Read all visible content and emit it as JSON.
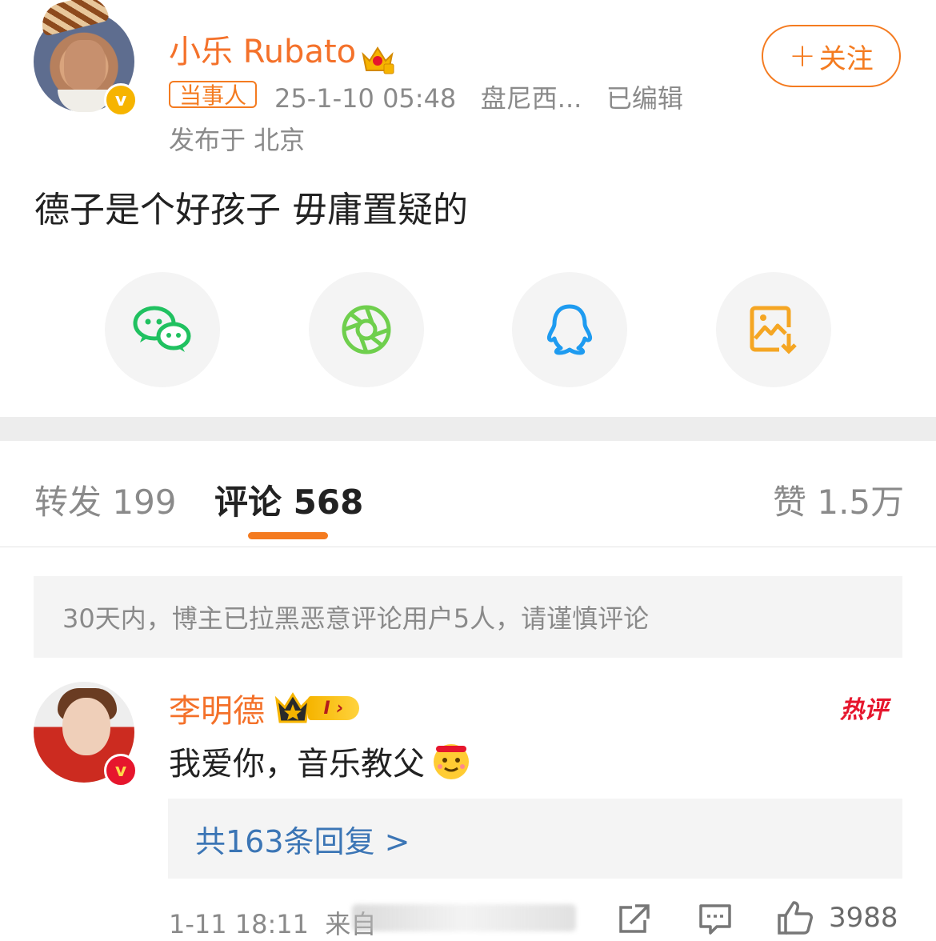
{
  "post": {
    "username": "小乐 Rubato",
    "tag": "当事人",
    "timestamp": "25-1-10 05:48",
    "source": "盘尼西...",
    "edited": "已编辑",
    "location": "发布于 北京",
    "follow_label": "关注",
    "content": "德子是个好孩子 毋庸置疑的"
  },
  "share": {
    "items": [
      {
        "name": "wechat-icon"
      },
      {
        "name": "moments-icon"
      },
      {
        "name": "qq-icon"
      },
      {
        "name": "save-image-icon"
      }
    ],
    "colors": {
      "wechat": "#20c160",
      "moments": "#6fcf4d",
      "qq": "#1e9bf0",
      "save": "#f5a623"
    }
  },
  "tabs": {
    "repost": "转发 199",
    "comments": "评论 568",
    "likes": "赞 1.5万"
  },
  "notice": "30天内，博主已拉黑恶意评论用户5人，请谨慎评论",
  "comment": {
    "username": "李明德",
    "level": "I",
    "hot_label": "热评",
    "text": "我爱你，音乐教父",
    "reply_link": "共163条回复 >",
    "time": "1-11 18:11",
    "source_prefix": "来自",
    "likes": "3988"
  },
  "colors": {
    "accent": "#f47b20",
    "link": "#3b75b5",
    "hot": "#e6162d"
  }
}
